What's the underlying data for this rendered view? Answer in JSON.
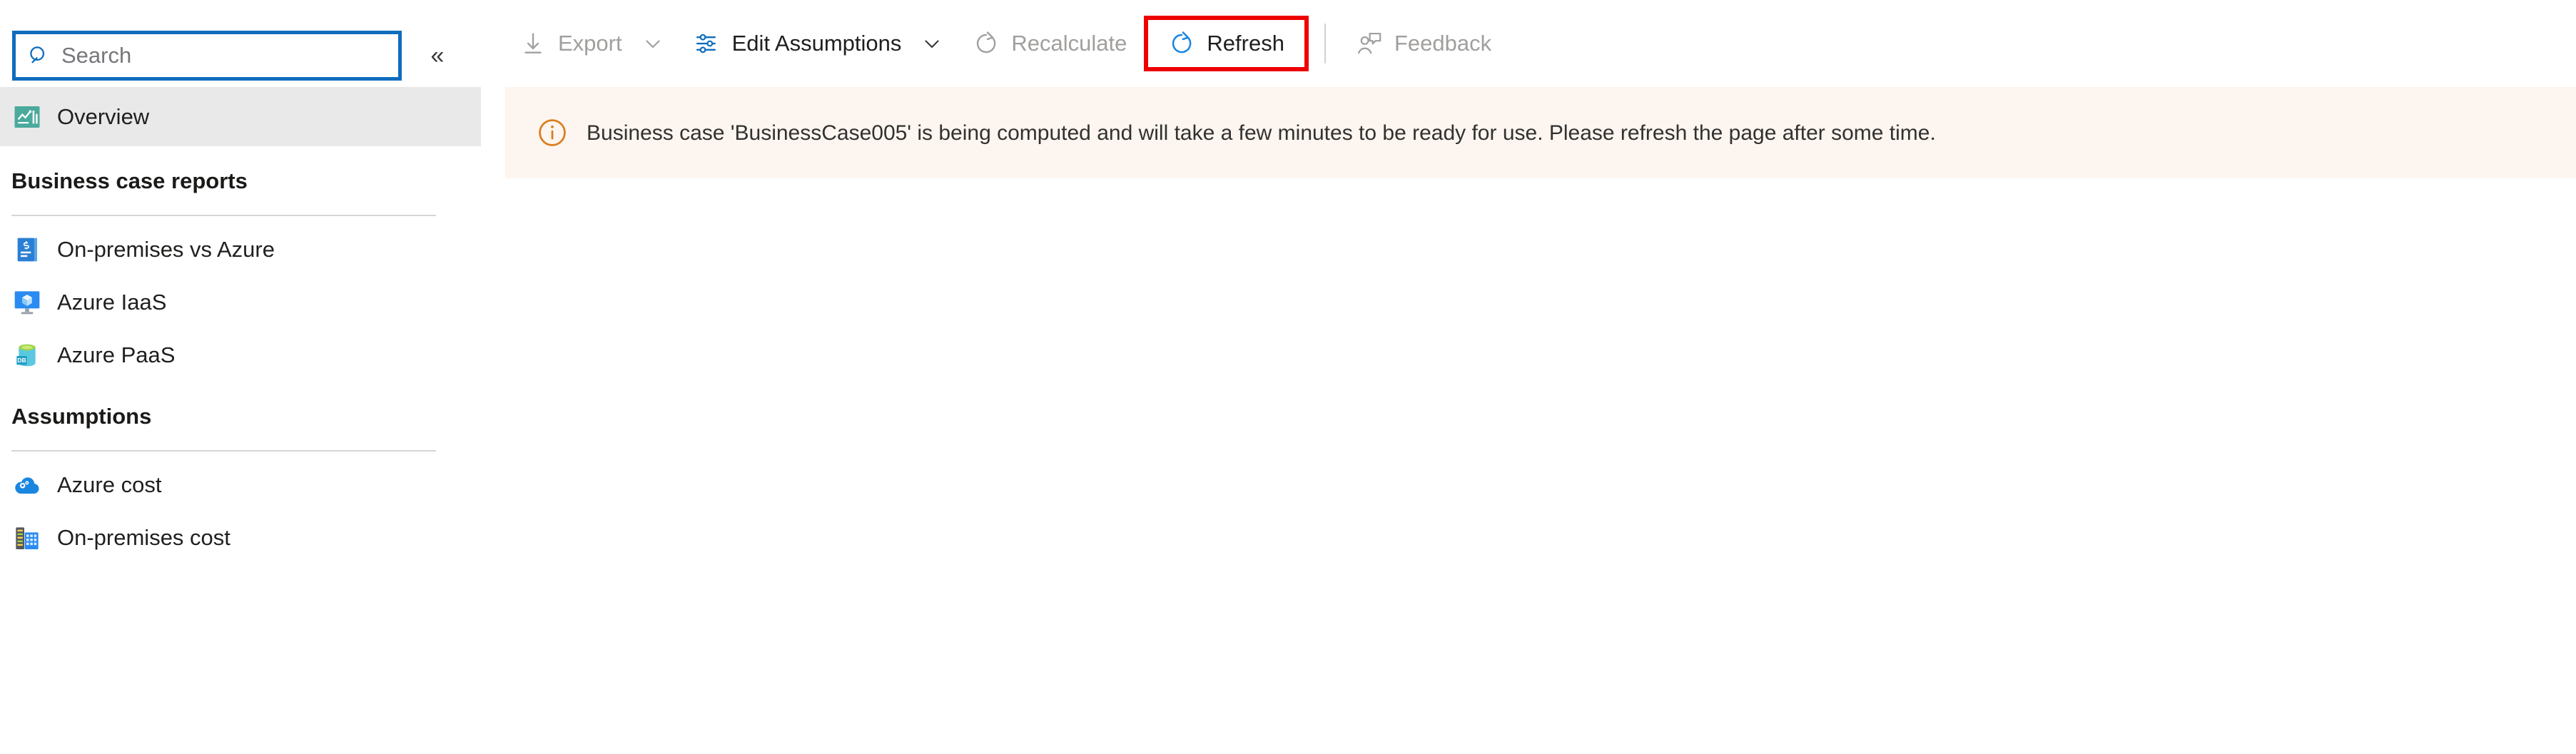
{
  "search": {
    "placeholder": "Search",
    "value": "",
    "icon": "search-icon"
  },
  "sidebar": {
    "collapse_label": "«",
    "overview": {
      "label": "Overview",
      "icon": "overview-chart-icon",
      "selected": true
    },
    "sections": [
      {
        "title": "Business case reports",
        "items": [
          {
            "label": "On-premises vs Azure",
            "icon": "invoice-icon"
          },
          {
            "label": "Azure IaaS",
            "icon": "virtual-machine-icon"
          },
          {
            "label": "Azure PaaS",
            "icon": "database-icon"
          }
        ]
      },
      {
        "title": "Assumptions",
        "items": [
          {
            "label": "Azure cost",
            "icon": "cloud-settings-icon"
          },
          {
            "label": "On-premises cost",
            "icon": "server-building-icon"
          }
        ]
      }
    ]
  },
  "toolbar": {
    "export": {
      "label": "Export",
      "icon": "download-icon",
      "chevron": "chevron-down-icon",
      "disabled": true
    },
    "edit_assumptions": {
      "label": "Edit Assumptions",
      "icon": "sliders-icon",
      "chevron": "chevron-down-icon",
      "disabled": false
    },
    "recalculate": {
      "label": "Recalculate",
      "icon": "refresh-circle-icon",
      "disabled": true
    },
    "refresh": {
      "label": "Refresh",
      "icon": "refresh-circle-icon",
      "disabled": false,
      "highlighted": true
    },
    "feedback": {
      "label": "Feedback",
      "icon": "person-feedback-icon",
      "disabled": true
    }
  },
  "banner": {
    "icon": "info-circle-icon",
    "message": "Business case 'BusinessCase005' is being computed and will take a few minutes to be ready for use. Please refresh the page after some time.",
    "close_icon": "close-icon"
  },
  "colors": {
    "accent_blue": "#0f6cbd",
    "highlight_red": "#ee0000",
    "banner_bg": "#fdf5ef",
    "banner_icon": "#d97e1f",
    "selected_nav_bg": "#e9e9e9",
    "disabled_text": "#a19f9d"
  }
}
